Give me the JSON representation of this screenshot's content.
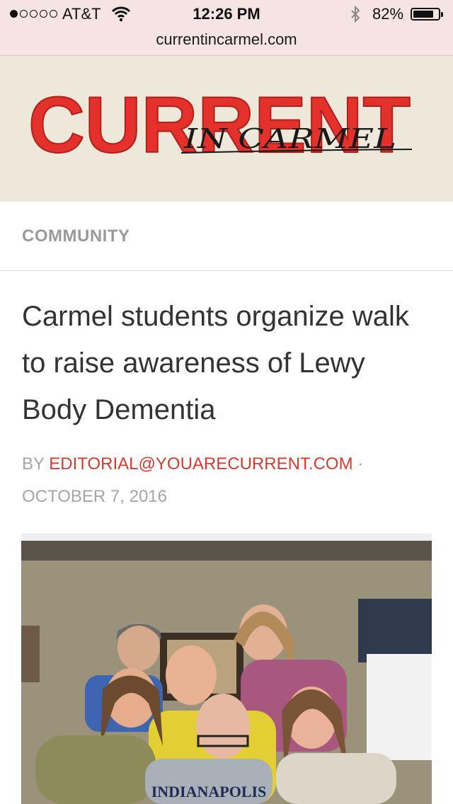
{
  "status_bar": {
    "carrier": "AT&T",
    "time": "12:26 PM",
    "battery_percent": "82%",
    "battery_level": 0.82,
    "signal_bars": 1,
    "signal_total": 5
  },
  "browser": {
    "url": "currentincarmel.com"
  },
  "masthead": {
    "logo_main": "CURRENT",
    "logo_sub": "IN CARMEL",
    "logo_color": "#e5312b"
  },
  "article": {
    "category": "COMMUNITY",
    "headline": "Carmel students organize walk to raise awareness of Lewy Body Dementia",
    "by_prefix": "BY",
    "author": "EDITORIAL@YOUARECURRENT.COM",
    "separator": "·",
    "date": "OCTOBER 7, 2016",
    "photo_shirt_text": "INDIANAPOLIS"
  },
  "colors": {
    "accent": "#d63a2f",
    "muted_text": "#a5a5a5",
    "heading_text": "#333333",
    "masthead_bg": "#ede8da",
    "status_bg": "#f6e4e4"
  },
  "icons": [
    "signal-dots",
    "wifi-icon",
    "bluetooth-icon",
    "battery-icon"
  ]
}
